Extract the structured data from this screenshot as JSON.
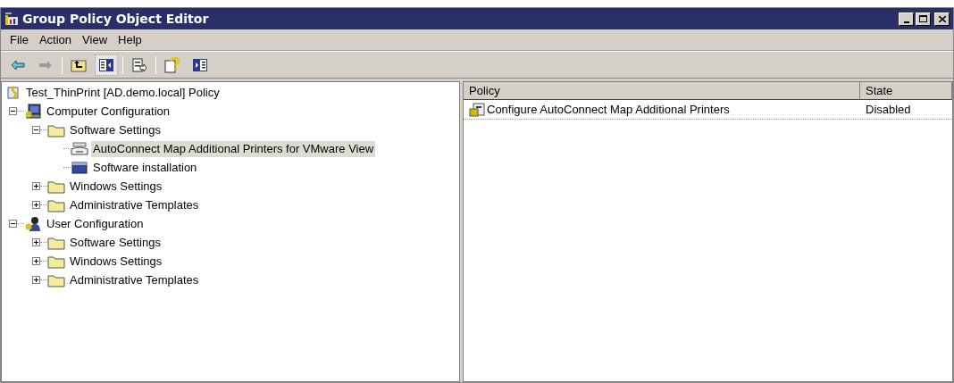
{
  "window": {
    "title": "Group Policy Object Editor"
  },
  "menu": [
    "File",
    "Action",
    "View",
    "Help"
  ],
  "toolbar": [
    {
      "kind": "back",
      "pressed": false
    },
    {
      "kind": "forward",
      "pressed": false
    },
    {
      "kind": "sep"
    },
    {
      "kind": "up",
      "pressed": false
    },
    {
      "kind": "tree",
      "pressed": true
    },
    {
      "kind": "sep"
    },
    {
      "kind": "export",
      "pressed": false
    },
    {
      "kind": "sep"
    },
    {
      "kind": "help",
      "pressed": false
    },
    {
      "kind": "pane",
      "pressed": false
    }
  ],
  "tree": {
    "label": "Test_ThinPrint [AD.demo.local] Policy",
    "kind": "root",
    "selected": false,
    "children": [
      {
        "label": "Computer Configuration",
        "kind": "computer",
        "expanded": true,
        "selected": false,
        "children": [
          {
            "label": "Software Settings",
            "kind": "folder",
            "expanded": true,
            "selected": false,
            "children": [
              {
                "label": "AutoConnect Map Additional Printers for VMware View",
                "kind": "extension",
                "selected": true
              },
              {
                "label": "Software installation",
                "kind": "install",
                "selected": false
              }
            ]
          },
          {
            "label": "Windows Settings",
            "kind": "folder",
            "expanded": false,
            "selected": false
          },
          {
            "label": "Administrative Templates",
            "kind": "folder",
            "expanded": false,
            "selected": false
          }
        ]
      },
      {
        "label": "User Configuration",
        "kind": "user",
        "expanded": true,
        "selected": false,
        "children": [
          {
            "label": "Software Settings",
            "kind": "folder",
            "expanded": false,
            "selected": false
          },
          {
            "label": "Windows Settings",
            "kind": "folder",
            "expanded": false,
            "selected": false
          },
          {
            "label": "Administrative Templates",
            "kind": "folder",
            "expanded": false,
            "selected": false
          }
        ]
      }
    ]
  },
  "list": {
    "columns": [
      "Policy",
      "State"
    ],
    "rows": [
      {
        "policy": "Configure AutoConnect Map Additional Printers",
        "state": "Disabled",
        "selected": false
      }
    ]
  }
}
